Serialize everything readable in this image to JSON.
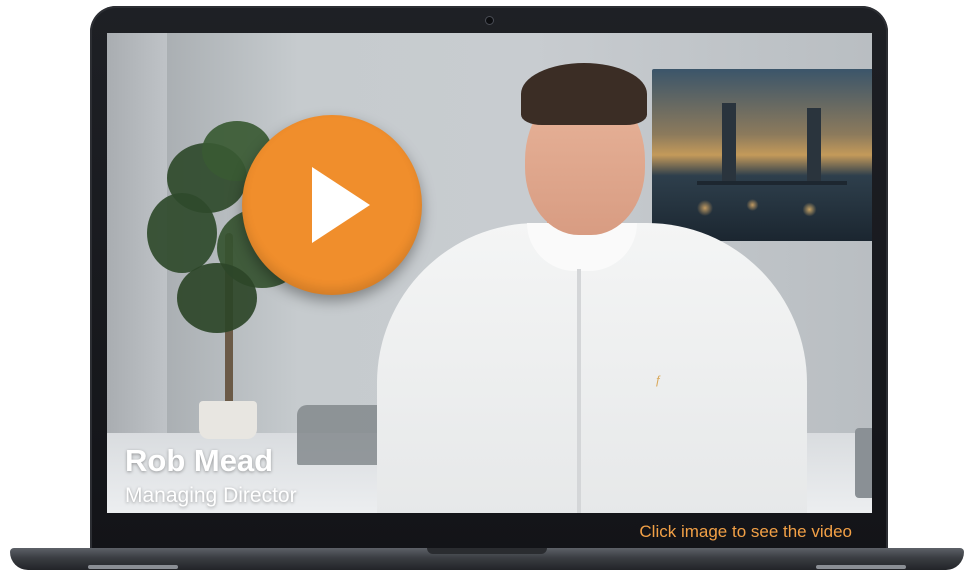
{
  "video": {
    "person_name": "Rob Mead",
    "person_role": "Managing Director",
    "hint": "Click image to see the video"
  },
  "icons": {
    "play": "play-icon",
    "camera": "camera-icon"
  },
  "colors": {
    "accent": "#f08e2c",
    "hint_text": "#f2a046",
    "bezel": "#16171b"
  }
}
